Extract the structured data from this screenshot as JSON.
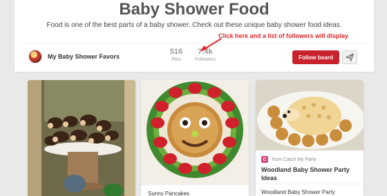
{
  "board": {
    "title": "Baby Shower Food",
    "description": "Food is one of the best parts of a baby shower. Check out these unique baby shower food ideas.",
    "owner_name": "My Baby Shower Favors",
    "pins_count": "516",
    "pins_label": "Pins",
    "followers_count": "7.4k",
    "followers_label": "Followers",
    "follow_label": "Follow board"
  },
  "annotation": {
    "text": "Click here and a list of followers will display",
    "color": "#e0252b"
  },
  "colors": {
    "follow_button": "#c8232c",
    "background": "#e9e9e9"
  },
  "icons": {
    "send": "send-icon",
    "avatar": "avatar"
  },
  "pins": [
    {
      "image": "cupcakes-on-wood-stand",
      "caption": ""
    },
    {
      "image": "pancake-face-with-strawberries",
      "caption": "Sunny Pancakes"
    },
    {
      "image": "hedgehog-cheese-ball-with-crackers",
      "source_icon": "C",
      "source": "from Catch My Party",
      "title": "Woodland Baby Shower Party Ideas",
      "subtitle": "Woodland Baby Shower Party"
    }
  ]
}
